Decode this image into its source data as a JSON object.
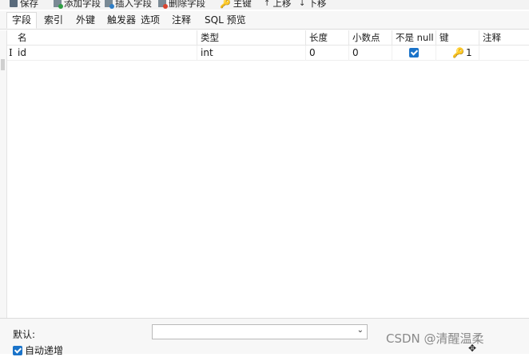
{
  "toolbar": {
    "save": "保存",
    "add_field": "添加字段",
    "insert_field": "插入字段",
    "delete_field": "删除字段",
    "primary_key": "主键",
    "move_up": "上移",
    "move_down": "下移"
  },
  "tabs": [
    "字段",
    "索引",
    "外键",
    "触发器",
    "选项",
    "注释",
    "SQL 预览"
  ],
  "active_tab": "字段",
  "columns": [
    "名",
    "类型",
    "长度",
    "小数点",
    "不是 null",
    "键",
    "注释"
  ],
  "rows": [
    {
      "name": "id",
      "type": "int",
      "length": "0",
      "decimals": "0",
      "not_null": true,
      "key": "1",
      "comment": ""
    }
  ],
  "footer": {
    "default_label": "默认:",
    "default_value": "",
    "auto_increment_label": "自动递增",
    "auto_increment_checked": true
  },
  "watermark": "CSDN @清醒温柔",
  "colors": {
    "accent": "#1a73c9",
    "key": "#d4a017"
  }
}
